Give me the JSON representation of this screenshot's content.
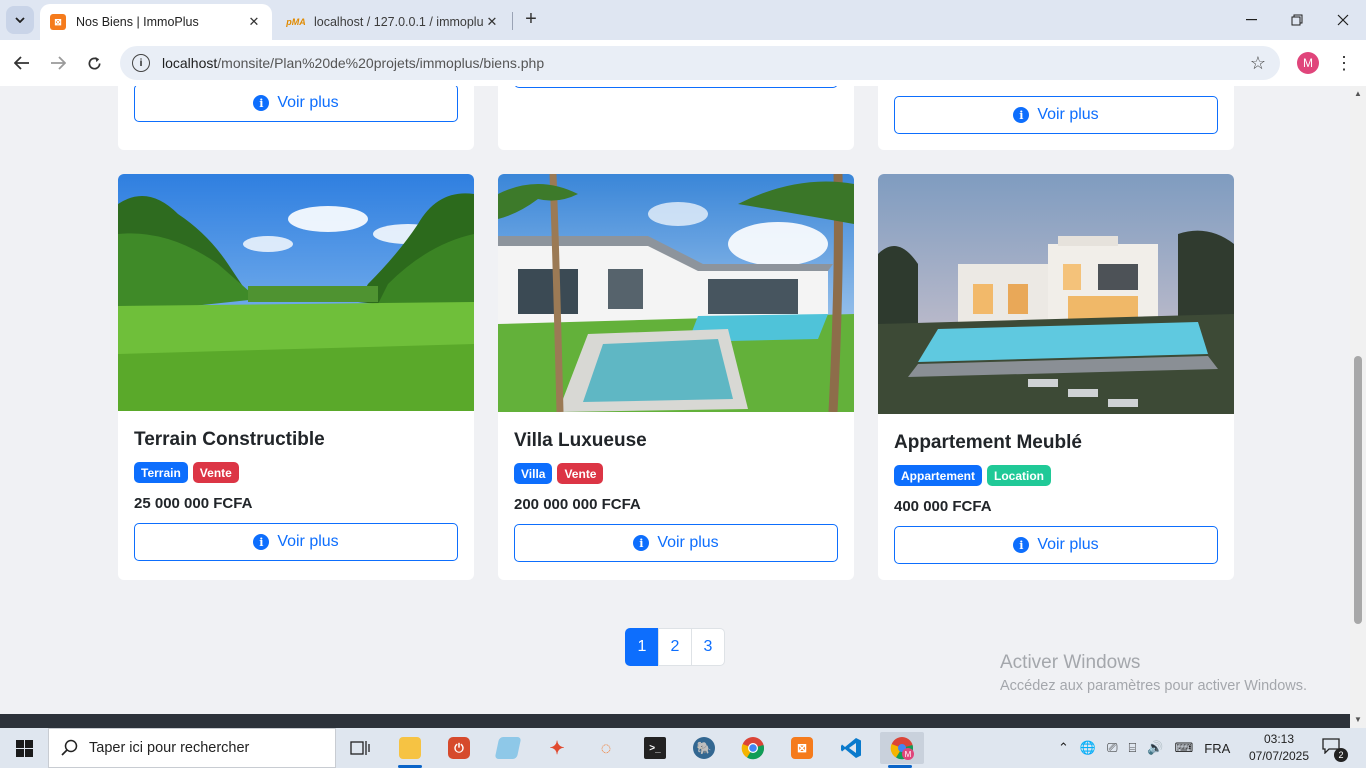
{
  "browser": {
    "tabs": [
      {
        "title": "Nos Biens | ImmoPlus",
        "favicon": "xampp-icon",
        "active": true
      },
      {
        "title": "localhost / 127.0.0.1 / immoplus",
        "favicon": "phpmyadmin-icon",
        "active": false
      }
    ],
    "url_host": "localhost",
    "url_path": "/monsite/Plan%20de%20projets/immoplus/biens.php",
    "profile_initial": "M"
  },
  "page": {
    "view_more_label": "Voir plus",
    "listings": [
      {
        "title": "Terrain Constructible",
        "badges": [
          {
            "label": "Terrain",
            "color": "#0d6efd"
          },
          {
            "label": "Vente",
            "color": "#dc3545"
          }
        ],
        "price": "25 000 000 FCFA",
        "image": "green-field-photo"
      },
      {
        "title": "Villa Luxueuse",
        "badges": [
          {
            "label": "Villa",
            "color": "#0d6efd"
          },
          {
            "label": "Vente",
            "color": "#dc3545"
          }
        ],
        "price": "200 000 000 FCFA",
        "image": "villa-pool-palms-photo"
      },
      {
        "title": "Appartement Meublé",
        "badges": [
          {
            "label": "Appartement",
            "color": "#0d6efd"
          },
          {
            "label": "Location",
            "color": "#20c997"
          }
        ],
        "price": "400 000 FCFA",
        "image": "modern-house-pool-photo"
      }
    ],
    "pagination": {
      "pages": [
        "1",
        "2",
        "3"
      ],
      "current": "1"
    },
    "watermark": {
      "title": "Activer Windows",
      "subtitle": "Accédez aux paramètres pour activer Windows."
    }
  },
  "taskbar": {
    "search_placeholder": "Taper ici pour rechercher",
    "language": "FRA",
    "time": "03:13",
    "date": "07/07/2025",
    "notification_count": "2"
  },
  "colors": {
    "primary": "#0d6efd",
    "danger": "#dc3545",
    "teal": "#20c997"
  }
}
